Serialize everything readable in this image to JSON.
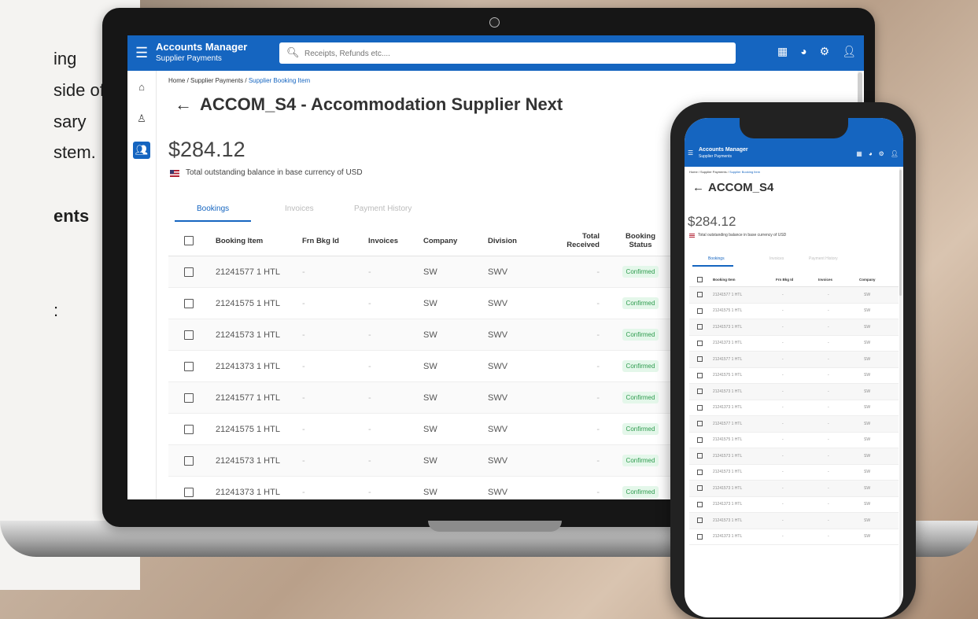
{
  "background_text": [
    "ing",
    "side of",
    "sary",
    "stem.",
    "ents",
    ":"
  ],
  "app": {
    "title": "Accounts Manager",
    "subtitle": "Supplier Payments",
    "search_placeholder": "Receipts, Refunds etc....",
    "icons": [
      "grid-icon",
      "palette-icon",
      "gear-icon",
      "user-icon"
    ],
    "rail": [
      "home-icon",
      "user-icon",
      "group-icon"
    ]
  },
  "breadcrumb": {
    "home": "Home",
    "sep1": " / ",
    "section": "Supplier Payments",
    "sep2": " / ",
    "current": "Supplier Booking Item"
  },
  "page": {
    "title": "ACCOM_S4 - Accommodation Supplier Next",
    "balance": "$284.12",
    "balance_desc": "Total outstanding balance in base currency of USD"
  },
  "tabs": [
    "Bookings",
    "Invoices",
    "Payment History"
  ],
  "table": {
    "columns": [
      "Booking Item",
      "Frn Bkg Id",
      "Invoices",
      "Company",
      "Division",
      "Total Received",
      "Booking Status"
    ],
    "rows": [
      {
        "item": "21241577 1 HTL",
        "frn": "-",
        "inv": "-",
        "company": "SW",
        "division": "SWV",
        "received": "-",
        "status": "Confirmed"
      },
      {
        "item": "21241575 1 HTL",
        "frn": "-",
        "inv": "-",
        "company": "SW",
        "division": "SWV",
        "received": "-",
        "status": "Confirmed"
      },
      {
        "item": "21241573 1 HTL",
        "frn": "-",
        "inv": "-",
        "company": "SW",
        "division": "SWV",
        "received": "-",
        "status": "Confirmed"
      },
      {
        "item": "21241373 1 HTL",
        "frn": "-",
        "inv": "-",
        "company": "SW",
        "division": "SWV",
        "received": "-",
        "status": "Confirmed"
      },
      {
        "item": "21241577 1 HTL",
        "frn": "-",
        "inv": "-",
        "company": "SW",
        "division": "SWV",
        "received": "-",
        "status": "Confirmed"
      },
      {
        "item": "21241575 1 HTL",
        "frn": "-",
        "inv": "-",
        "company": "SW",
        "division": "SWV",
        "received": "-",
        "status": "Confirmed"
      },
      {
        "item": "21241573 1 HTL",
        "frn": "-",
        "inv": "-",
        "company": "SW",
        "division": "SWV",
        "received": "-",
        "status": "Confirmed"
      },
      {
        "item": "21241373 1 HTL",
        "frn": "-",
        "inv": "-",
        "company": "SW",
        "division": "SWV",
        "received": "-",
        "status": "Confirmed"
      }
    ]
  },
  "phone": {
    "heading": "ACCOM_S4",
    "columns": [
      "Booking Item",
      "Frn Bkg Id",
      "Invoices",
      "Company"
    ],
    "rows": [
      {
        "item": "21241577 1 HTL",
        "frn": "-",
        "inv": "-",
        "company": "SW"
      },
      {
        "item": "21241575 1 HTL",
        "frn": "-",
        "inv": "-",
        "company": "SW"
      },
      {
        "item": "21241573 1 HTL",
        "frn": "-",
        "inv": "-",
        "company": "SW"
      },
      {
        "item": "21241373 1 HTL",
        "frn": "-",
        "inv": "-",
        "company": "SW"
      },
      {
        "item": "21241577 1 HTL",
        "frn": "-",
        "inv": "-",
        "company": "SW"
      },
      {
        "item": "21241575 1 HTL",
        "frn": "-",
        "inv": "-",
        "company": "SW"
      },
      {
        "item": "21241573 1 HTL",
        "frn": "-",
        "inv": "-",
        "company": "SW"
      },
      {
        "item": "21241373 1 HTL",
        "frn": "-",
        "inv": "-",
        "company": "SW"
      },
      {
        "item": "21241577 1 HTL",
        "frn": "-",
        "inv": "-",
        "company": "SW"
      },
      {
        "item": "21241575 1 HTL",
        "frn": "-",
        "inv": "-",
        "company": "SW"
      },
      {
        "item": "21241573 1 HTL",
        "frn": "-",
        "inv": "-",
        "company": "SW"
      },
      {
        "item": "21241573 1 HTL",
        "frn": "-",
        "inv": "-",
        "company": "SW"
      },
      {
        "item": "21241573 1 HTL",
        "frn": "-",
        "inv": "-",
        "company": "SW"
      },
      {
        "item": "21241373 1 HTL",
        "frn": "-",
        "inv": "-",
        "company": "SW"
      },
      {
        "item": "21241573 1 HTL",
        "frn": "-",
        "inv": "-",
        "company": "SW"
      },
      {
        "item": "21241373 1 HTL",
        "frn": "-",
        "inv": "-",
        "company": "SW"
      }
    ]
  },
  "colors": {
    "primary": "#1565c0",
    "status_bg": "#e4f7ea",
    "status_fg": "#2e9b4e"
  }
}
